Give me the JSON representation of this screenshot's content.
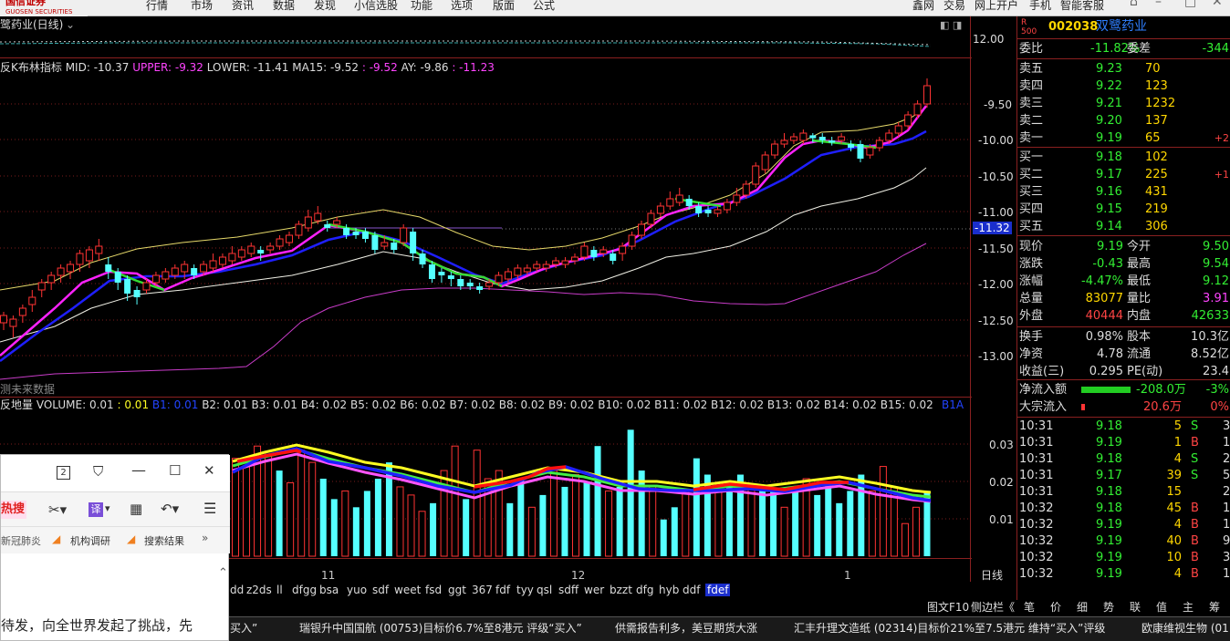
{
  "topbar": {
    "logo_sub": "GUOSEN SECURITIES",
    "menu": [
      "行情",
      "市场",
      "资讯",
      "数据",
      "发现",
      "小信选股",
      "功能",
      "选项",
      "版面",
      "公式",
      "鑫网",
      "交易",
      "网上开户",
      "手机",
      "智能客服"
    ]
  },
  "chart_top": {
    "title": "鹭药业(日线)",
    "future_data": "测未来数据",
    "period": "日线"
  },
  "chart_data": {
    "type": "candlestick",
    "indicator": {
      "name": "反K布林指标",
      "mid": "MID: -10.37",
      "upper": "UPPER: -9.32",
      "lower": "LOWER: -11.41",
      "ma15": "MA15: -9.52",
      "extra1": ": -9.52",
      "ay": "AY: -9.86",
      "extra2": ": -11.23"
    },
    "volume": {
      "name": "反地量",
      "volume": "VOLUME: 0.01",
      "v0": ": 0.01",
      "b1": "B1: 0.01",
      "rest": "B2: 0.01  B3: 0.01  B4: 0.02  B5: 0.02  B6: 0.02  B7: 0.02  B8: 0.02  B9: 0.02  B10: 0.02  B11: 0.02  B12: 0.02  B13: 0.02  B14: 0.02  B15: 0.02",
      "b1a": "B1A"
    },
    "top_axis": [
      "12.00"
    ],
    "y_ticks": [
      "-9.50",
      "-10.00",
      "-10.50",
      "-11.00",
      "-11.50",
      "-12.00",
      "-12.50",
      "-13.00"
    ],
    "y_range": [
      -13.45,
      -9.0
    ],
    "current_marker": "-11.32",
    "vol_ticks": [
      "0.03",
      "0.02",
      "0.01"
    ],
    "vol_range": [
      0,
      0.038
    ],
    "dates": [
      "11",
      "12",
      "1"
    ],
    "candles": [
      [
        -12.55,
        -12.45,
        -12.4,
        -12.65
      ],
      [
        -12.6,
        -12.5,
        -12.45,
        -12.75
      ],
      [
        -12.45,
        -12.35,
        -12.3,
        -12.55
      ],
      [
        -12.3,
        -12.2,
        -12.1,
        -12.4
      ],
      [
        -12.1,
        -12.0,
        -11.95,
        -12.2
      ],
      [
        -12.0,
        -11.9,
        -11.85,
        -12.1
      ],
      [
        -11.9,
        -11.8,
        -11.75,
        -12.0
      ],
      [
        -11.85,
        -11.75,
        -11.7,
        -11.95
      ],
      [
        -11.75,
        -11.6,
        -11.55,
        -11.85
      ],
      [
        -11.7,
        -11.55,
        -11.5,
        -11.8
      ],
      [
        -11.6,
        -11.5,
        -11.4,
        -11.7
      ],
      [
        -11.75,
        -11.85,
        -11.65,
        -11.95
      ],
      [
        -11.85,
        -12.0,
        -11.8,
        -12.1
      ],
      [
        -11.95,
        -12.15,
        -11.9,
        -12.25
      ],
      [
        -12.1,
        -12.2,
        -12.05,
        -12.3
      ],
      [
        -12.1,
        -12.0,
        -11.95,
        -12.15
      ],
      [
        -12.0,
        -11.9,
        -11.85,
        -12.05
      ],
      [
        -11.95,
        -11.85,
        -11.8,
        -12.0
      ],
      [
        -11.9,
        -11.8,
        -11.75,
        -11.95
      ],
      [
        -11.85,
        -11.75,
        -11.7,
        -11.95
      ],
      [
        -11.8,
        -11.9,
        -11.75,
        -11.95
      ],
      [
        -11.85,
        -11.75,
        -11.7,
        -11.9
      ],
      [
        -11.8,
        -11.7,
        -11.6,
        -11.85
      ],
      [
        -11.75,
        -11.65,
        -11.6,
        -11.8
      ],
      [
        -11.7,
        -11.6,
        -11.5,
        -11.75
      ],
      [
        -11.65,
        -11.55,
        -11.5,
        -11.7
      ],
      [
        -11.6,
        -11.5,
        -11.45,
        -11.65
      ],
      [
        -11.55,
        -11.6,
        -11.5,
        -11.7
      ],
      [
        -11.55,
        -11.5,
        -11.45,
        -11.6
      ],
      [
        -11.5,
        -11.4,
        -11.35,
        -11.55
      ],
      [
        -11.45,
        -11.35,
        -11.3,
        -11.5
      ],
      [
        -11.35,
        -11.2,
        -11.15,
        -11.4
      ],
      [
        -11.25,
        -11.1,
        -11.0,
        -11.3
      ],
      [
        -11.15,
        -11.05,
        -10.95,
        -11.2
      ],
      [
        -11.2,
        -11.25,
        -11.15,
        -11.3
      ],
      [
        -11.2,
        -11.15,
        -11.1,
        -11.25
      ],
      [
        -11.25,
        -11.35,
        -11.2,
        -11.4
      ],
      [
        -11.3,
        -11.35,
        -11.25,
        -11.4
      ],
      [
        -11.3,
        -11.4,
        -11.25,
        -11.45
      ],
      [
        -11.35,
        -11.55,
        -11.3,
        -11.6
      ],
      [
        -11.5,
        -11.45,
        -11.35,
        -11.55
      ],
      [
        -11.45,
        -11.55,
        -11.4,
        -11.6
      ],
      [
        -11.45,
        -11.25,
        -11.2,
        -11.5
      ],
      [
        -11.3,
        -11.6,
        -11.25,
        -11.7
      ],
      [
        -11.6,
        -11.75,
        -11.55,
        -11.8
      ],
      [
        -11.75,
        -11.95,
        -11.7,
        -12.0
      ],
      [
        -11.85,
        -11.9,
        -11.8,
        -12.0
      ],
      [
        -11.9,
        -11.95,
        -11.85,
        -12.05
      ],
      [
        -11.95,
        -12.05,
        -11.9,
        -12.1
      ],
      [
        -12.0,
        -12.05,
        -11.95,
        -12.1
      ],
      [
        -12.05,
        -12.1,
        -12.0,
        -12.15
      ],
      [
        -12.05,
        -12.0,
        -11.95,
        -12.1
      ],
      [
        -12.0,
        -11.9,
        -11.85,
        -12.05
      ],
      [
        -11.95,
        -11.85,
        -11.8,
        -12.0
      ],
      [
        -11.9,
        -11.8,
        -11.75,
        -11.95
      ],
      [
        -11.85,
        -11.8,
        -11.75,
        -11.9
      ],
      [
        -11.8,
        -11.75,
        -11.7,
        -11.85
      ],
      [
        -11.8,
        -11.75,
        -11.7,
        -11.85
      ],
      [
        -11.75,
        -11.7,
        -11.65,
        -11.8
      ],
      [
        -11.75,
        -11.7,
        -11.65,
        -11.8
      ],
      [
        -11.7,
        -11.65,
        -11.6,
        -11.75
      ],
      [
        -11.65,
        -11.5,
        -11.45,
        -11.7
      ],
      [
        -11.55,
        -11.65,
        -11.5,
        -11.7
      ],
      [
        -11.6,
        -11.55,
        -11.5,
        -11.65
      ],
      [
        -11.6,
        -11.7,
        -11.55,
        -11.75
      ],
      [
        -11.6,
        -11.5,
        -11.45,
        -11.7
      ],
      [
        -11.5,
        -11.35,
        -11.3,
        -11.55
      ],
      [
        -11.35,
        -11.2,
        -11.15,
        -11.4
      ],
      [
        -11.2,
        -11.05,
        -11.0,
        -11.25
      ],
      [
        -11.05,
        -10.95,
        -10.9,
        -11.1
      ],
      [
        -10.95,
        -10.85,
        -10.75,
        -11.0
      ],
      [
        -10.9,
        -10.8,
        -10.7,
        -10.95
      ],
      [
        -10.85,
        -10.95,
        -10.8,
        -11.0
      ],
      [
        -10.95,
        -11.05,
        -10.9,
        -11.1
      ],
      [
        -11.0,
        -11.05,
        -10.95,
        -11.1
      ],
      [
        -11.05,
        -11.0,
        -10.95,
        -11.1
      ],
      [
        -11.0,
        -10.9,
        -10.85,
        -11.05
      ],
      [
        -10.9,
        -10.8,
        -10.7,
        -10.95
      ],
      [
        -10.8,
        -10.65,
        -10.6,
        -10.85
      ],
      [
        -10.65,
        -10.4,
        -10.35,
        -10.7
      ],
      [
        -10.45,
        -10.25,
        -10.2,
        -10.5
      ],
      [
        -10.25,
        -10.1,
        -10.05,
        -10.3
      ],
      [
        -10.1,
        -10.05,
        -9.95,
        -10.15
      ],
      [
        -10.05,
        -10.0,
        -9.95,
        -10.1
      ],
      [
        -10.05,
        -9.95,
        -9.9,
        -10.1
      ],
      [
        -9.98,
        -10.02,
        -9.95,
        -10.08
      ],
      [
        -10.0,
        -10.05,
        -9.95,
        -10.1
      ],
      [
        -10.05,
        -10.08,
        -10.0,
        -10.12
      ],
      [
        -10.05,
        -10.0,
        -9.95,
        -10.1
      ],
      [
        -10.1,
        -10.15,
        -10.05,
        -10.2
      ],
      [
        -10.1,
        -10.3,
        -10.05,
        -10.35
      ],
      [
        -10.25,
        -10.15,
        -10.1,
        -10.3
      ],
      [
        -10.15,
        -10.05,
        -10.0,
        -10.2
      ],
      [
        -10.05,
        -9.95,
        -9.9,
        -10.1
      ],
      [
        -9.95,
        -9.85,
        -9.8,
        -10.0
      ],
      [
        -9.85,
        -9.7,
        -9.65,
        -9.9
      ],
      [
        -9.7,
        -9.55,
        -9.5,
        -9.75
      ],
      [
        -9.55,
        -9.3,
        -9.2,
        -9.6
      ]
    ],
    "volumes": [
      [
        0.024,
        "u"
      ],
      [
        0.022,
        "u"
      ],
      [
        0.027,
        "u"
      ],
      [
        0.025,
        "u"
      ],
      [
        0.021,
        "d"
      ],
      [
        0.018,
        "u"
      ],
      [
        0.026,
        "u"
      ],
      [
        0.023,
        "u"
      ],
      [
        0.019,
        "d"
      ],
      [
        0.014,
        "d"
      ],
      [
        0.016,
        "u"
      ],
      [
        0.012,
        "d"
      ],
      [
        0.016,
        "d"
      ],
      [
        0.019,
        "d"
      ],
      [
        0.023,
        "d"
      ],
      [
        0.017,
        "u"
      ],
      [
        0.015,
        "u"
      ],
      [
        0.011,
        "u"
      ],
      [
        0.013,
        "d"
      ],
      [
        0.021,
        "u"
      ],
      [
        0.027,
        "u"
      ],
      [
        0.014,
        "d"
      ],
      [
        0.026,
        "u"
      ],
      [
        0.019,
        "u"
      ],
      [
        0.021,
        "u"
      ],
      [
        0.013,
        "d"
      ],
      [
        0.019,
        "d"
      ],
      [
        0.012,
        "u"
      ],
      [
        0.015,
        "d"
      ],
      [
        0.021,
        "u"
      ],
      [
        0.017,
        "d"
      ],
      [
        0.02,
        "u"
      ],
      [
        0.018,
        "d"
      ],
      [
        0.027,
        "d"
      ],
      [
        0.016,
        "u"
      ],
      [
        0.017,
        "d"
      ],
      [
        0.031,
        "d"
      ],
      [
        0.021,
        "d"
      ],
      [
        0.017,
        "u"
      ],
      [
        0.009,
        "d"
      ],
      [
        0.012,
        "d"
      ],
      [
        0.016,
        "u"
      ],
      [
        0.024,
        "d"
      ],
      [
        0.02,
        "d"
      ],
      [
        0.016,
        "u"
      ],
      [
        0.018,
        "d"
      ],
      [
        0.02,
        "d"
      ],
      [
        0.017,
        "u"
      ],
      [
        0.016,
        "d"
      ],
      [
        0.016,
        "d"
      ],
      [
        0.012,
        "u"
      ],
      [
        0.016,
        "d"
      ],
      [
        0.019,
        "u"
      ],
      [
        0.015,
        "d"
      ],
      [
        0.018,
        "d"
      ],
      [
        0.013,
        "d"
      ],
      [
        0.016,
        "d"
      ],
      [
        0.02,
        "d"
      ],
      [
        0.016,
        "u"
      ],
      [
        0.022,
        "u"
      ],
      [
        0.017,
        "u"
      ],
      [
        0.008,
        "u"
      ],
      [
        0.012,
        "u"
      ],
      [
        0.016,
        "d"
      ]
    ]
  },
  "quote": {
    "code": "002038",
    "name": "双鹭药业",
    "weibi_label": "委比",
    "weibi": "-11.82%",
    "weicha_label": "委差",
    "weicha": "-344",
    "asks": [
      {
        "label": "卖五",
        "price": "9.23",
        "vol": "70",
        "chg": ""
      },
      {
        "label": "卖四",
        "price": "9.22",
        "vol": "123",
        "chg": ""
      },
      {
        "label": "卖三",
        "price": "9.21",
        "vol": "1232",
        "chg": ""
      },
      {
        "label": "卖二",
        "price": "9.20",
        "vol": "137",
        "chg": ""
      },
      {
        "label": "卖一",
        "price": "9.19",
        "vol": "65",
        "chg": "+2"
      }
    ],
    "bids": [
      {
        "label": "买一",
        "price": "9.18",
        "vol": "102",
        "chg": ""
      },
      {
        "label": "买二",
        "price": "9.17",
        "vol": "225",
        "chg": "+1"
      },
      {
        "label": "买三",
        "price": "9.16",
        "vol": "431",
        "chg": ""
      },
      {
        "label": "买四",
        "price": "9.15",
        "vol": "219",
        "chg": ""
      },
      {
        "label": "买五",
        "price": "9.14",
        "vol": "306",
        "chg": ""
      }
    ],
    "stats": [
      {
        "l1": "现价",
        "v1": "9.19",
        "c1": "#33ee33",
        "l2": "今开",
        "v2": "9.50",
        "c2": "#33ee33"
      },
      {
        "l1": "涨跌",
        "v1": "-0.43",
        "c1": "#33ee33",
        "l2": "最高",
        "v2": "9.54",
        "c2": "#33ee33"
      },
      {
        "l1": "涨幅",
        "v1": "-4.47%",
        "c1": "#33ee33",
        "l2": "最低",
        "v2": "9.12",
        "c2": "#33ee33"
      },
      {
        "l1": "总量",
        "v1": "83077",
        "c1": "#ffd700",
        "l2": "量比",
        "v2": "3.91",
        "c2": "#ff44ff"
      },
      {
        "l1": "外盘",
        "v1": "40444",
        "c1": "#ff4444",
        "l2": "内盘",
        "v2": "42633",
        "c2": "#33ee33"
      }
    ],
    "stats2": [
      {
        "l1": "换手",
        "v1": "0.98%",
        "c1": "#ddd",
        "l2": "股本",
        "v2": "10.3亿",
        "c2": "#ddd"
      },
      {
        "l1": "净资",
        "v1": "4.78",
        "c1": "#ddd",
        "l2": "流通",
        "v2": "8.52亿",
        "c2": "#ddd"
      },
      {
        "l1": "收益(三)",
        "v1": "0.295",
        "c1": "#ddd",
        "l2": "PE(动)",
        "v2": "23.4",
        "c2": "#ddd"
      }
    ],
    "net_inflow_label": "净流入额",
    "net_inflow": "-208.0万",
    "net_inflow_pct": "-3%",
    "block_inflow_label": "大宗流入",
    "block_inflow": "20.6万",
    "block_inflow_pct": "0%",
    "ticks": [
      {
        "t": "10:31",
        "p": "9.18",
        "v": "5",
        "s": "S",
        "n": "3"
      },
      {
        "t": "10:31",
        "p": "9.19",
        "v": "1",
        "s": "B",
        "n": "1"
      },
      {
        "t": "10:31",
        "p": "9.18",
        "v": "4",
        "s": "S",
        "n": "2"
      },
      {
        "t": "10:31",
        "p": "9.17",
        "v": "39",
        "s": "S",
        "n": "5"
      },
      {
        "t": "10:31",
        "p": "9.18",
        "v": "15",
        "s": "",
        "n": "2"
      },
      {
        "t": "10:32",
        "p": "9.18",
        "v": "45",
        "s": "B",
        "n": "1"
      },
      {
        "t": "10:32",
        "p": "9.19",
        "v": "4",
        "s": "B",
        "n": "1"
      },
      {
        "t": "10:32",
        "p": "9.19",
        "v": "40",
        "s": "B",
        "n": "9"
      },
      {
        "t": "10:32",
        "p": "9.19",
        "v": "10",
        "s": "B",
        "n": "3"
      },
      {
        "t": "10:32",
        "p": "9.19",
        "v": "4",
        "s": "B",
        "n": "1"
      }
    ]
  },
  "tabs": [
    "dd",
    "z2ds",
    "ll",
    "dfgg",
    "bsa",
    "yuo",
    "sdf",
    "weet",
    "fsd",
    "ggt",
    "367",
    "fdf",
    "tyy",
    "qsl",
    "sdff",
    "wer",
    "bzzt",
    "dfg",
    "hyb",
    "ddf",
    "fdef"
  ],
  "statusbar": {
    "f10": "图文F10",
    "sidebar": "侧边栏《",
    "right_tabs": [
      "笔",
      "价",
      "细",
      "势",
      "联",
      "值",
      "主",
      "筹"
    ]
  },
  "ticker": [
    "买入”",
    "瑞银升中国国航 (00753)目标价6.7%至8港元 评级“买入”",
    "供需报告利多，美豆期货大涨",
    "汇丰升理文造纸 (02314)目标价21%至7.5港元  维持“买入”评级",
    "欧康维视生物 (01"
  ],
  "popup": {
    "tab_count": "2",
    "hot_label": "热搜",
    "translate": "译",
    "bookmarks": [
      "新冠肺炎",
      "机构调研",
      "搜索结果"
    ],
    "article": "待发，向全世界发起了挑战，先"
  },
  "colors": {
    "up": "#ff3333",
    "down": "#55ffff",
    "mid": "#ff22ff",
    "ma15": "#1f1fff",
    "upper_band": "#e6d96a"
  }
}
